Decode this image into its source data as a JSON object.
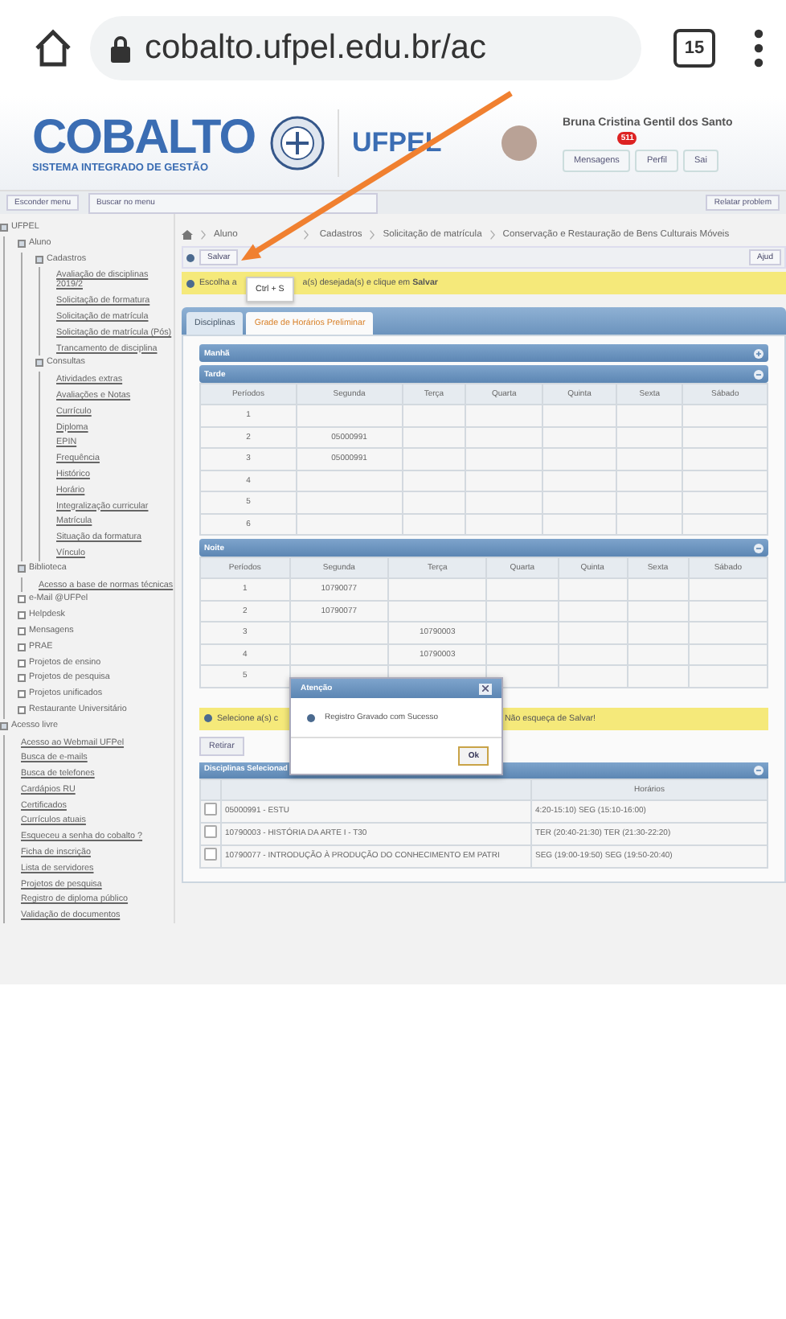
{
  "browser": {
    "url": "cobalto.ufpel.edu.br/ac",
    "tab_count": "15"
  },
  "header": {
    "logo": "COBALTO",
    "logo_subtitle": "SISTEMA INTEGRADO DE GESTÃO",
    "institution": "UFPEL",
    "user_name": "Bruna Cristina Gentil dos Santo",
    "messages_badge": "511",
    "user_buttons": [
      "Mensagens",
      "Perfil",
      "Sai"
    ]
  },
  "toolbar": {
    "hide_menu": "Esconder menu",
    "search_placeholder": "Buscar no menu",
    "report": "Relatar problem"
  },
  "sidebar": {
    "tree": [
      {
        "label": "UFPEL",
        "expanded": true,
        "children": [
          {
            "label": "Aluno",
            "expanded": true,
            "children": [
              {
                "label": "Cadastros",
                "expanded": true,
                "children": [
                  {
                    "label": "Avaliação de disciplinas 2019/2"
                  },
                  {
                    "label": "Solicitação de formatura"
                  },
                  {
                    "label": "Solicitação de matrícula"
                  },
                  {
                    "label": "Solicitação de matrícula (Pós)"
                  },
                  {
                    "label": "Trancamento de disciplina"
                  }
                ]
              },
              {
                "label": "Consultas",
                "expanded": true,
                "children": [
                  {
                    "label": "Atividades extras"
                  },
                  {
                    "label": "Avaliações e Notas"
                  },
                  {
                    "label": "Currículo"
                  },
                  {
                    "label": "Diploma"
                  },
                  {
                    "label": "EPIN"
                  },
                  {
                    "label": "Frequência"
                  },
                  {
                    "label": "Histórico"
                  },
                  {
                    "label": "Horário"
                  },
                  {
                    "label": "Integralização curricular"
                  },
                  {
                    "label": "Matrícula"
                  },
                  {
                    "label": "Situação da formatura"
                  },
                  {
                    "label": "Vínculo"
                  }
                ]
              }
            ]
          },
          {
            "label": "Biblioteca",
            "expanded": true,
            "children": [
              {
                "label": "Acesso a base de normas técnicas"
              }
            ]
          },
          {
            "label": "e-Mail @UFPel",
            "expanded": false
          },
          {
            "label": "Helpdesk",
            "expanded": false
          },
          {
            "label": "Mensagens",
            "expanded": false
          },
          {
            "label": "PRAE",
            "expanded": false
          },
          {
            "label": "Projetos de ensino",
            "expanded": false
          },
          {
            "label": "Projetos de pesquisa",
            "expanded": false
          },
          {
            "label": "Projetos unificados",
            "expanded": false
          },
          {
            "label": "Restaurante Universitário",
            "expanded": false
          }
        ]
      },
      {
        "label": "Acesso livre",
        "expanded": true,
        "children": [
          {
            "label": "Acesso ao Webmail UFPel"
          },
          {
            "label": "Busca de e-mails"
          },
          {
            "label": "Busca de telefones"
          },
          {
            "label": "Cardápios RU"
          },
          {
            "label": "Certificados"
          },
          {
            "label": "Currículos atuais"
          },
          {
            "label": "Esqueceu a senha do cobalto ?"
          },
          {
            "label": "Ficha de inscrição"
          },
          {
            "label": "Lista de servidores"
          },
          {
            "label": "Projetos de pesquisa"
          },
          {
            "label": "Registro de diploma público"
          },
          {
            "label": "Validação de documentos"
          }
        ]
      }
    ]
  },
  "breadcrumb": [
    "Aluno",
    "Cadastros",
    "Solicitação de matrícula",
    "Conservação e Restauração de Bens Culturais Móveis"
  ],
  "actions": {
    "save": "Salvar",
    "help": "Ajud",
    "shortcut_tooltip": "Ctrl + S"
  },
  "notice_top": {
    "before": "Escolha a",
    "after": "a(s) desejada(s) e clique em **Salvar**"
  },
  "tabs": [
    {
      "label": "Disciplinas",
      "selected": false
    },
    {
      "label": "Grade de Horários Preliminar",
      "selected": true
    }
  ],
  "periods": [
    {
      "title": "Manhã",
      "expanded": false
    },
    {
      "title": "Tarde",
      "expanded": true,
      "columns": [
        "Períodos",
        "Segunda",
        "Terça",
        "Quarta",
        "Quinta",
        "Sexta",
        "Sábado"
      ],
      "rows": [
        {
          "period": "1"
        },
        {
          "period": "2",
          "segunda": "05000991"
        },
        {
          "period": "3",
          "segunda": "05000991"
        },
        {
          "period": "4"
        },
        {
          "period": "5"
        },
        {
          "period": "6"
        }
      ]
    },
    {
      "title": "Noite",
      "expanded": true,
      "columns": [
        "Períodos",
        "Segunda",
        "Terça",
        "Quarta",
        "Quinta",
        "Sexta",
        "Sábado"
      ],
      "rows": [
        {
          "period": "1",
          "segunda": "10790077"
        },
        {
          "period": "2",
          "segunda": "10790077"
        },
        {
          "period": "3",
          "terca": "10790003"
        },
        {
          "period": "4",
          "terca": "10790003"
        },
        {
          "period": "5"
        }
      ]
    }
  ],
  "notice_bottom": {
    "before": "Selecione a(s) c",
    "after": "Não esqueça de Salvar!"
  },
  "remove_button": "Retirar",
  "selected_disciplines": {
    "title": "Disciplinas Selecionad",
    "horarios_header": "Horários",
    "rows": [
      {
        "checked": false,
        "discipline": "05000991 - ESTU",
        "horarios": "4:20-15:10) SEG (15:10-16:00)"
      },
      {
        "checked": false,
        "discipline": "10790003 - HISTÓRIA DA ARTE I - T30",
        "horarios": "TER (20:40-21:30) TER (21:30-22:20)"
      },
      {
        "checked": false,
        "discipline": "10790077 - INTRODUÇÃO À PRODUÇÃO DO CONHECIMENTO EM PATRI",
        "horarios": "SEG (19:00-19:50) SEG (19:50-20:40)"
      }
    ]
  },
  "dialog": {
    "title": "Atenção",
    "message": "Registro Gravado com Sucesso",
    "ok": "Ok"
  }
}
